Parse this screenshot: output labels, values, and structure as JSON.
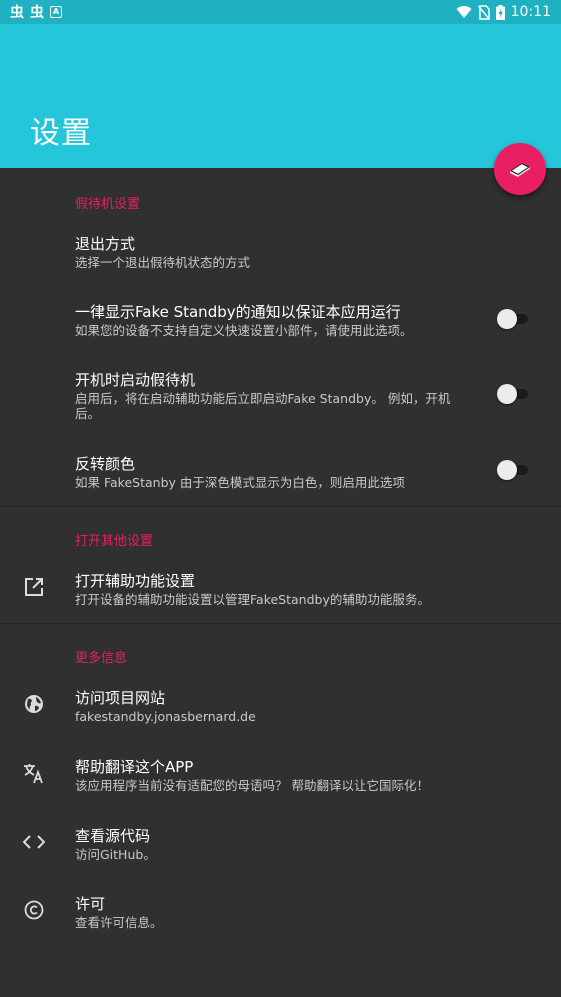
{
  "status_bar": {
    "left_icons": [
      "虫",
      "虫"
    ],
    "right_icons": [
      "wifi-icon",
      "no-sim-icon",
      "battery-charging-icon"
    ],
    "time": "10:11"
  },
  "app_bar": {
    "title": "设置"
  },
  "sections": [
    {
      "title": "假待机设置",
      "items": [
        {
          "title": "退出方式",
          "subtitle": "选择一个退出假待机状态的方式"
        },
        {
          "title": "一律显示Fake Standby的通知以保证本应用运行",
          "subtitle": "如果您的设备不支持自定义快速设置小部件，请使用此选项。",
          "toggle": false
        },
        {
          "title": "开机时启动假待机",
          "subtitle": "启用后，将在启动辅助功能后立即启动Fake Standby。 例如，开机后。",
          "toggle": false
        },
        {
          "title": "反转颜色",
          "subtitle": "如果 FakeStanby 由于深色模式显示为白色，则启用此选项",
          "toggle": false
        }
      ]
    },
    {
      "title": "打开其他设置",
      "items": [
        {
          "title": "打开辅助功能设置",
          "subtitle": "打开设备的辅助功能设置以管理FakeStandby的辅助功能服务。",
          "icon": "open-in-new-icon"
        }
      ]
    },
    {
      "title": "更多信息",
      "items": [
        {
          "title": "访问项目网站",
          "subtitle": "fakestandby.jonasbernard.de",
          "icon": "globe-icon"
        },
        {
          "title": "帮助翻译这个APP",
          "subtitle": "该应用程序当前没有适配您的母语吗？ 帮助翻译以让它国际化！",
          "icon": "translate-icon"
        },
        {
          "title": "查看源代码",
          "subtitle": "访问GitHub。",
          "icon": "code-icon"
        },
        {
          "title": "许可",
          "subtitle": "查看许可信息。",
          "icon": "copyright-icon"
        }
      ]
    }
  ],
  "colors": {
    "status_bar": "#1fb1c2",
    "app_bar": "#25c6d9",
    "background": "#303030",
    "accent": "#e91e63"
  }
}
